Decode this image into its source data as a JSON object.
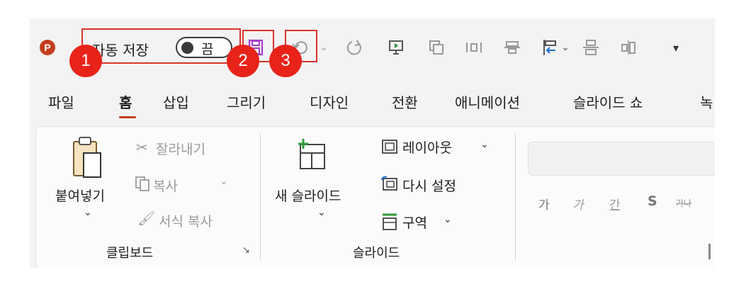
{
  "qat": {
    "autosave_label": "자동 저장",
    "autosave_state": "끔",
    "badges": [
      "1",
      "2",
      "3"
    ]
  },
  "tabs": [
    "파일",
    "홈",
    "삽입",
    "그리기",
    "디자인",
    "전환",
    "애니메이션",
    "슬라이드 쇼",
    "녹"
  ],
  "ribbon": {
    "clipboard": {
      "paste": "붙여넣기",
      "cut": "잘라내기",
      "copy": "복사",
      "format_painter": "서식 복사",
      "group_label": "클립보드"
    },
    "slides": {
      "new_slide": "새 슬라이드",
      "layout": "레이아웃",
      "reset": "다시 설정",
      "section": "구역",
      "group_label": "슬라이드"
    },
    "font": {
      "bold": "가",
      "italic": "가",
      "underline": "간",
      "shadow": "S",
      "strike": "가나"
    }
  },
  "colors": {
    "brand": "#c43e1c",
    "badge": "#e8231a",
    "highlight_box": "#d9342b",
    "save_purple": "#a43ec7"
  }
}
